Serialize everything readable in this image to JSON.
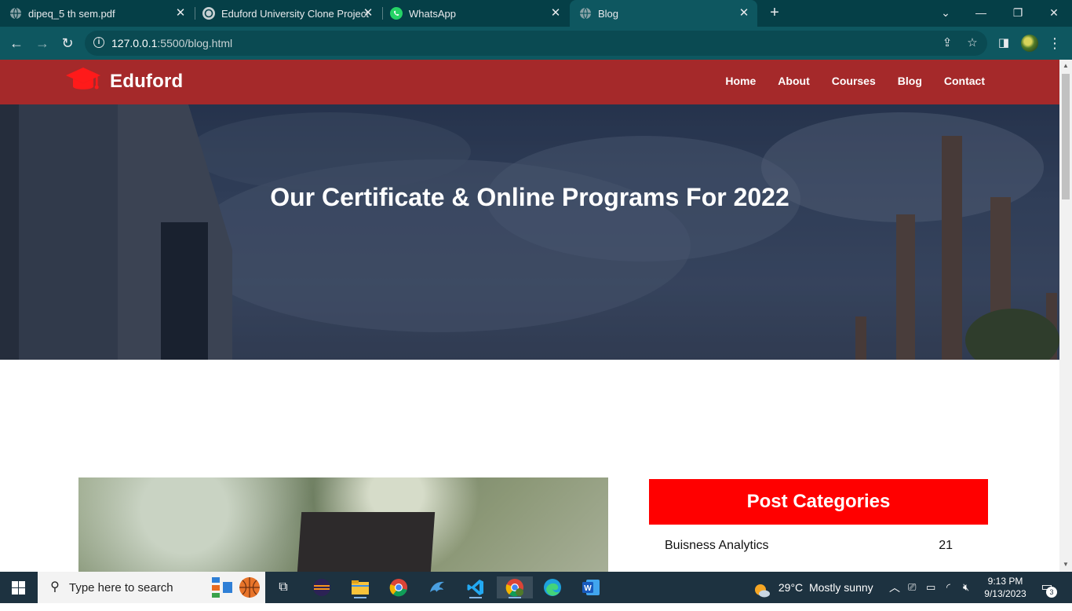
{
  "browser": {
    "tabs": [
      {
        "title": "dipeq_5 th sem.pdf",
        "icon": "globe-icon"
      },
      {
        "title": "Eduford University Clone Project",
        "icon": "chatgpt-icon"
      },
      {
        "title": "WhatsApp",
        "icon": "whatsapp-icon"
      },
      {
        "title": "Blog",
        "icon": "globe-icon",
        "active": true
      }
    ],
    "url_host": "127.0.0.1",
    "url_rest": ":5500/blog.html"
  },
  "site": {
    "brand": "Eduford",
    "nav": [
      "Home",
      "About",
      "Courses",
      "Blog",
      "Contact"
    ],
    "hero_title": "Our Certificate & Online Programs For 2022",
    "categories_title": "Post Categories",
    "categories": [
      {
        "name": "Buisness Analytics",
        "count": "21"
      }
    ],
    "colors": {
      "nav_bg": "#a5292a",
      "accent": "#ff0000"
    }
  },
  "taskbar": {
    "search_placeholder": "Type here to search",
    "weather": "29°C  Mostly sunny",
    "time": "9:13 PM",
    "date": "9/13/2023",
    "notifications": "3"
  }
}
